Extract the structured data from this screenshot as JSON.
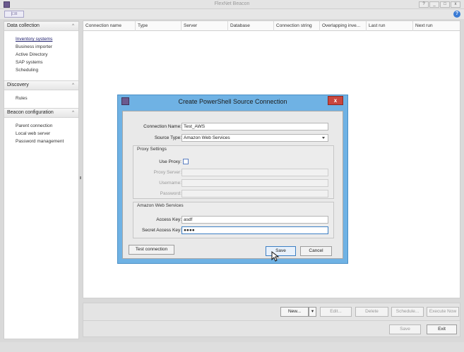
{
  "window": {
    "title": "FlexNet Beacon",
    "help_label": "?",
    "minimize_label": "_",
    "maximize_label": "□",
    "close_label": "x",
    "help_icon": "question-icon",
    "help_glyph": "?"
  },
  "toolbar": {
    "menu_button_label": "|□≡"
  },
  "sidebar": {
    "sections": [
      {
        "label": "Data collection",
        "items": [
          "Inventory systems",
          "Business importer",
          "Active Directory",
          "SAP systems",
          "Scheduling"
        ]
      },
      {
        "label": "Discovery",
        "items": [
          "Rules"
        ]
      },
      {
        "label": "Beacon configuration",
        "items": [
          "Parent connection",
          "Local web server",
          "Password management"
        ]
      }
    ],
    "chevron": "^"
  },
  "grid": {
    "columns": [
      "Connection name",
      "Type",
      "Server",
      "Database",
      "Connection string",
      "Overlapping inve...",
      "Last run",
      "Next run"
    ]
  },
  "bottom_bar": {
    "new_label": "New...",
    "dropdown_label": "▾",
    "edit_label": "Edit...",
    "delete_label": "Delete",
    "schedule_label": "Schedule...",
    "execute_label": "Execute Now",
    "save_label": "Save",
    "exit_label": "Exit"
  },
  "dialog": {
    "title": "Create PowerShell Source Connection",
    "close_label": "x",
    "connection_name_label": "Connection Name:",
    "connection_name_value": "Test_AWS",
    "source_type_label": "Source Type:",
    "source_type_value": "Amazon Web Services",
    "proxy_group_title": "Proxy Settings",
    "use_proxy_label": "Use Proxy:",
    "proxy_server_label": "Proxy Server:",
    "username_label": "Username:",
    "password_label": "Password:",
    "aws_group_title": "Amazon Web Services",
    "access_key_label": "Access Key:",
    "access_key_value": "asdf",
    "secret_key_label": "Secret Access Key:",
    "secret_key_value": "●●●●",
    "test_button_label": "Test connection",
    "save_button_label": "Save",
    "cancel_button_label": "Cancel"
  },
  "colors": {
    "dialog_border": "#6fb2e4",
    "close_red": "#c9463d",
    "app_purple": "#6b5a8e"
  }
}
